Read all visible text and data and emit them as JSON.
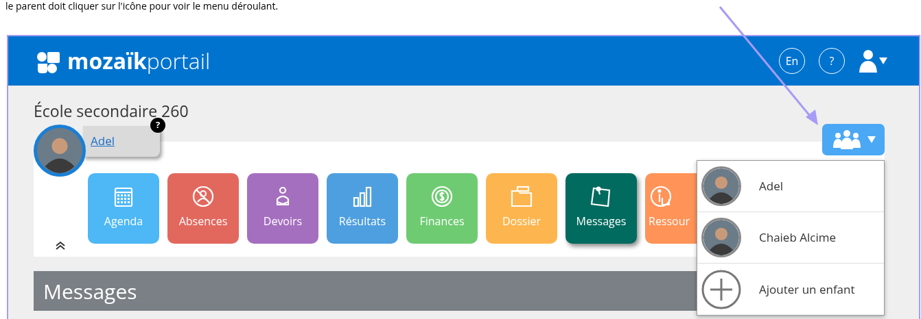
{
  "caption": "le parent doit cliquer sur l'icône pour voir le menu déroulant.",
  "header": {
    "logo_bold": "mozaïk",
    "logo_light": "portail",
    "language": "En",
    "help": "?"
  },
  "school": "École secondaire 260",
  "student": {
    "name": "Adel",
    "badge": "?"
  },
  "tiles": [
    {
      "label": "Agenda",
      "color": "#4db8f5",
      "selected": false
    },
    {
      "label": "Absences",
      "color": "#e2685e",
      "selected": false
    },
    {
      "label": "Devoirs",
      "color": "#a56fbf",
      "selected": false
    },
    {
      "label": "Résultats",
      "color": "#4e9fe0",
      "selected": false
    },
    {
      "label": "Finances",
      "color": "#6fcb72",
      "selected": false
    },
    {
      "label": "Dossier",
      "color": "#fdb64f",
      "selected": false
    },
    {
      "label": "Messages",
      "color": "#006b5e",
      "selected": true
    },
    {
      "label": "Ressour",
      "color": "#ff9358",
      "selected": false
    }
  ],
  "section_title": "Messages",
  "children_menu": {
    "expanded": true,
    "items": [
      {
        "kind": "child",
        "label": "Adel"
      },
      {
        "kind": "child",
        "label": "Chaieb Alcime"
      },
      {
        "kind": "add",
        "label": "Ajouter un enfant"
      }
    ]
  }
}
